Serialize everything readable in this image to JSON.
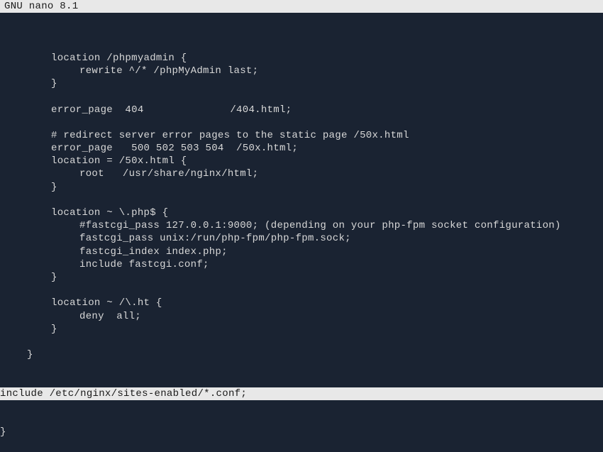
{
  "title_bar": "  GNU nano 8.1",
  "lines": [
    {
      "cls": "ml-0",
      "text": ""
    },
    {
      "cls": "ml-8",
      "text": "location /phpmyadmin {"
    },
    {
      "cls": "ml-12",
      "text": "rewrite ^/* /phpMyAdmin last;"
    },
    {
      "cls": "ml-8",
      "text": "}"
    },
    {
      "cls": "ml-0",
      "text": ""
    },
    {
      "cls": "ml-8",
      "text": "error_page  404              /404.html;"
    },
    {
      "cls": "ml-0",
      "text": ""
    },
    {
      "cls": "ml-8",
      "text": "# redirect server error pages to the static page /50x.html"
    },
    {
      "cls": "ml-8",
      "text": "error_page   500 502 503 504  /50x.html;"
    },
    {
      "cls": "ml-8",
      "text": "location = /50x.html {"
    },
    {
      "cls": "ml-12",
      "text": "root   /usr/share/nginx/html;"
    },
    {
      "cls": "ml-8",
      "text": "}"
    },
    {
      "cls": "ml-0",
      "text": ""
    },
    {
      "cls": "ml-8",
      "text": "location ~ \\.php$ {"
    },
    {
      "cls": "ml-12",
      "text": "#fastcgi_pass 127.0.0.1:9000; (depending on your php-fpm socket configuration)"
    },
    {
      "cls": "ml-12",
      "text": "fastcgi_pass unix:/run/php-fpm/php-fpm.sock;"
    },
    {
      "cls": "ml-12",
      "text": "fastcgi_index index.php;"
    },
    {
      "cls": "ml-12",
      "text": "include fastcgi.conf;"
    },
    {
      "cls": "ml-8",
      "text": "}"
    },
    {
      "cls": "ml-0",
      "text": ""
    },
    {
      "cls": "ml-8",
      "text": "location ~ /\\.ht {"
    },
    {
      "cls": "ml-12",
      "text": "deny  all;"
    },
    {
      "cls": "ml-8",
      "text": "}"
    },
    {
      "cls": "ml-0",
      "text": ""
    },
    {
      "cls": "ml-4",
      "text": "}"
    }
  ],
  "highlighted_line": "include /etc/nginx/sites-enabled/*.conf;",
  "post_highlight": [
    {
      "cls": "ml-0",
      "text": "}"
    }
  ]
}
